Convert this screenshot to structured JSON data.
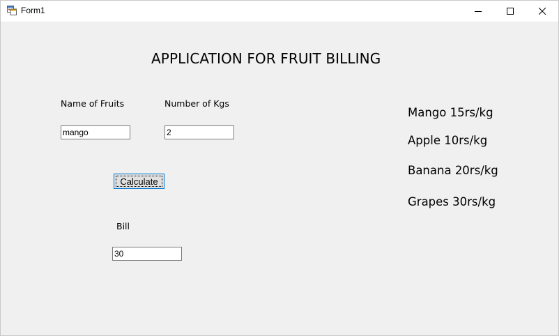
{
  "window": {
    "title": "Form1"
  },
  "form": {
    "heading": "APPLICATION FOR FRUIT BILLING",
    "fruit_label": "Name of Fruits",
    "fruit_value": "mango",
    "kgs_label": "Number of Kgs",
    "kgs_value": "2",
    "calculate_label": "Calculate",
    "bill_label": "Bill",
    "bill_value": "30"
  },
  "prices": [
    "Mango 15rs/kg",
    "Apple 10rs/kg",
    "Banana 20rs/kg",
    "Grapes 30rs/kg"
  ],
  "icons": {
    "app": "app-icon",
    "minimize": "minimize-icon",
    "maximize": "maximize-icon",
    "close": "close-icon"
  }
}
